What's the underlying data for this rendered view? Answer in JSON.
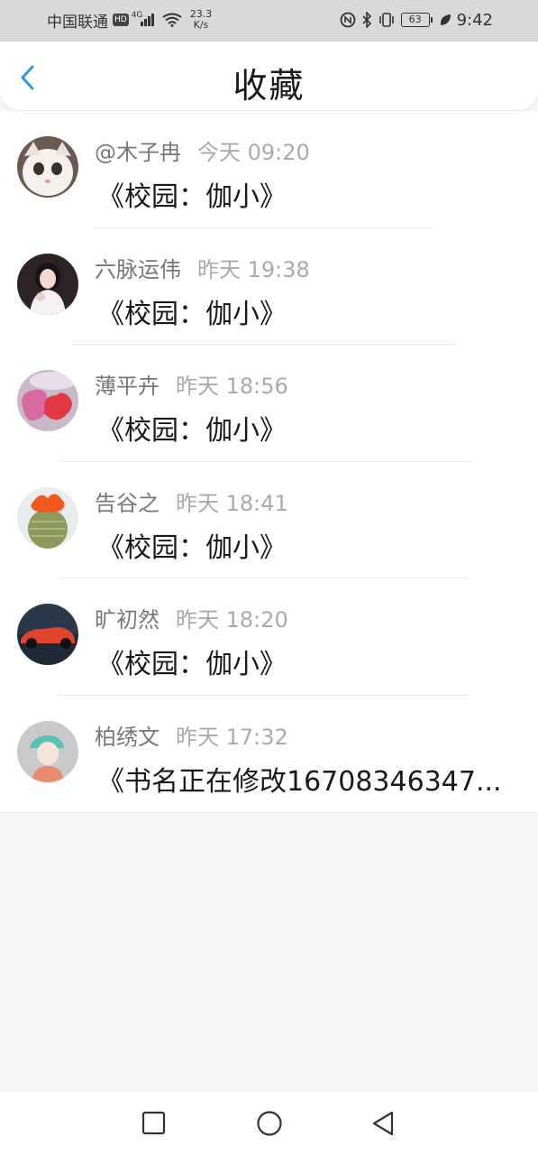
{
  "status_bar": {
    "carrier": "中国联通",
    "hd": "HD",
    "network": "4G",
    "speed_value": "23.3",
    "speed_unit": "K/s",
    "battery": "63",
    "time": "9:42"
  },
  "header": {
    "title": "收藏"
  },
  "favorites": [
    {
      "name": "@木子冉",
      "time": "今天 09:20",
      "title": "《校园：伽小》"
    },
    {
      "name": "六脉运伟",
      "time": "昨天 19:38",
      "title": "《校园：伽小》"
    },
    {
      "name": "薄平卉",
      "time": "昨天 18:56",
      "title": "《校园：伽小》"
    },
    {
      "name": "告谷之",
      "time": "昨天 18:41",
      "title": "《校园：伽小》"
    },
    {
      "name": "旷初然",
      "time": "昨天 18:20",
      "title": "《校园：伽小》"
    },
    {
      "name": "柏绣文",
      "time": "昨天 17:32",
      "title": "《书名正在修改16708346347..."
    }
  ],
  "colors": {
    "accent": "#2b9bf0",
    "status_bar_bg": "#d9d9d9",
    "page_bg": "#f7f6f7"
  },
  "icons": {
    "back": "chevron-left-icon",
    "nav_recent": "square-icon",
    "nav_home": "circle-icon",
    "nav_back": "triangle-back-icon"
  }
}
